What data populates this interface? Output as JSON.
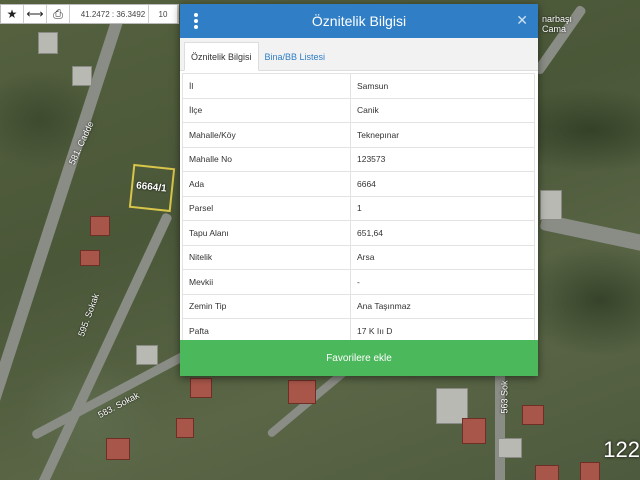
{
  "toolbar": {
    "coordinates": "41.2472 : 36.3492",
    "zoom": "10"
  },
  "map": {
    "parcel_label": "6664/1",
    "street_labels": [
      "581. Cadde",
      "595. Sokak",
      "583. Sokak",
      "563 Sok",
      "narbaşı",
      "Cama"
    ],
    "corner_number": "122"
  },
  "modal": {
    "title": "Öznitelik Bilgisi",
    "tabs": [
      "Öznitelik Bilgisi",
      "Bina/BB Listesi"
    ],
    "rows": [
      {
        "key": "İl",
        "value": "Samsun"
      },
      {
        "key": "İlçe",
        "value": "Canik"
      },
      {
        "key": "Mahalle/Köy",
        "value": "Teknepınar"
      },
      {
        "key": "Mahalle No",
        "value": "123573"
      },
      {
        "key": "Ada",
        "value": "6664"
      },
      {
        "key": "Parsel",
        "value": "1"
      },
      {
        "key": "Tapu Alanı",
        "value": "651,64"
      },
      {
        "key": "Nitelik",
        "value": "Arsa"
      },
      {
        "key": "Mevkii",
        "value": "-"
      },
      {
        "key": "Zemin Tip",
        "value": "Ana Taşınmaz"
      },
      {
        "key": "Pafta",
        "value": "17 K Iıı D"
      }
    ],
    "favorite_button": "Favorilere ekle"
  },
  "colors": {
    "header": "#2f7ec6",
    "favorite": "#4cb85c"
  }
}
